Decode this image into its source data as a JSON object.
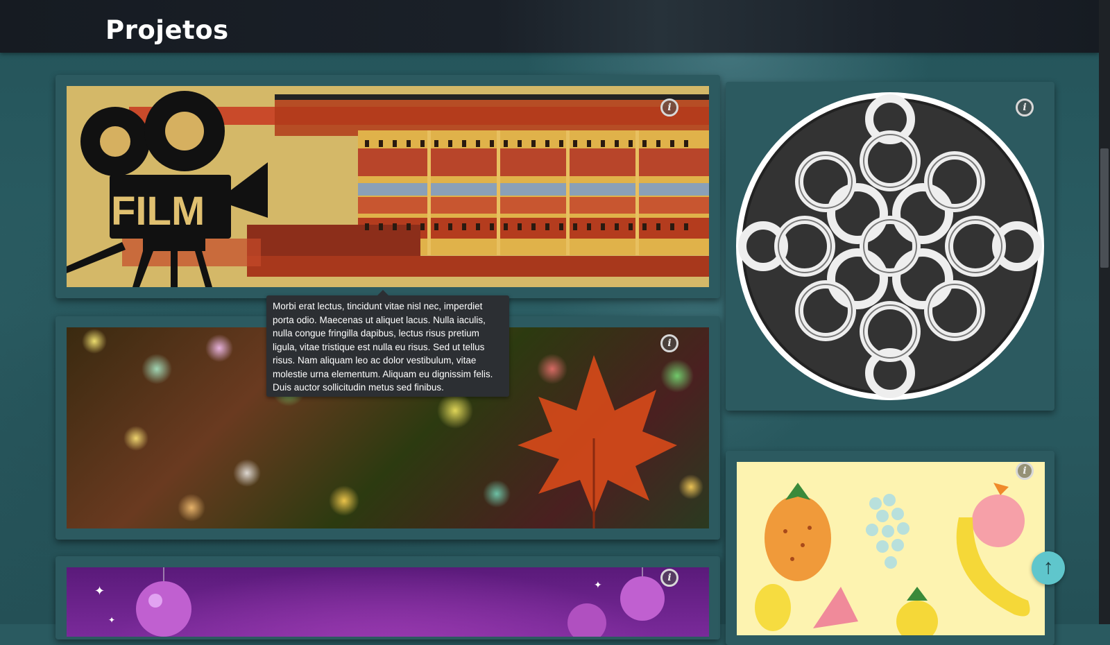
{
  "header": {
    "title": "Projetos"
  },
  "projects": [
    {
      "name": "film",
      "info_icon": "info-icon"
    },
    {
      "name": "bokeh-leaf",
      "info_icon": "info-icon"
    },
    {
      "name": "christmas",
      "info_icon": "info-icon"
    },
    {
      "name": "celtic-knot",
      "info_icon": "info-icon"
    },
    {
      "name": "fruits",
      "info_icon": "info-icon"
    }
  ],
  "tooltip": {
    "text": "Morbi erat lectus, tincidunt vitae nisl nec, imperdiet porta odio. Maecenas ut aliquet lacus. Nulla iaculis, nulla congue fringilla dapibus, lectus risus pretium ligula, vitae tristique est nulla eu risus. Sed ut tellus risus. Nam aliquam leo ac dolor vestibulum, vitae molestie urna elementum. Aliquam eu dignissim felis. Duis auctor sollicitudin metus sed finibus."
  },
  "film_image": {
    "text": "FILM"
  },
  "info_glyph": "i",
  "back_to_top_glyph": "↑",
  "colors": {
    "accent": "#5fc6cc",
    "header_bg": "#161b22",
    "card_bg": "#2c5a60"
  }
}
